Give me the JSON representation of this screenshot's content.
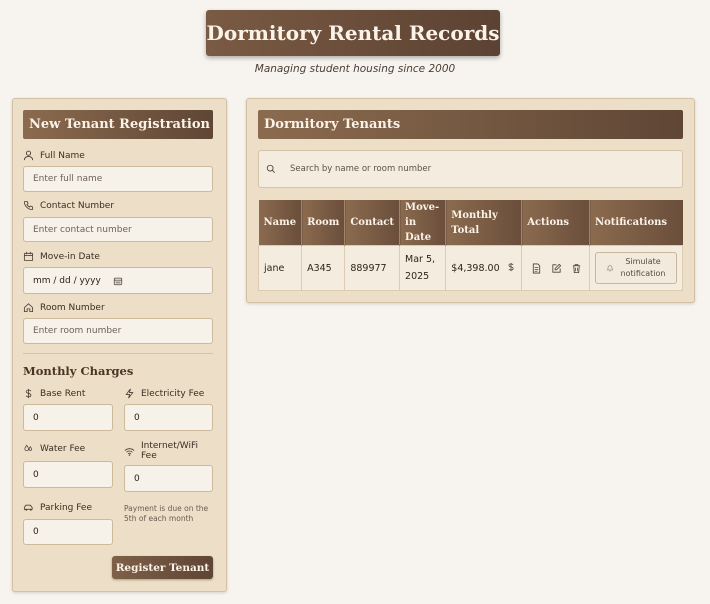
{
  "header": {
    "title": "Dormitory Rental Records",
    "subtitle": "Managing student housing since 2000"
  },
  "form": {
    "title": "New Tenant Registration",
    "full_name": {
      "label": "Full Name",
      "placeholder": "Enter full name"
    },
    "contact": {
      "label": "Contact Number",
      "placeholder": "Enter contact number"
    },
    "move_in": {
      "label": "Move-in Date",
      "placeholder": "mm / dd / yyyy"
    },
    "room": {
      "label": "Room Number",
      "placeholder": "Enter room number"
    },
    "charges_title": "Monthly Charges",
    "base_rent": {
      "label": "Base Rent",
      "value": "0"
    },
    "electricity": {
      "label": "Electricity Fee",
      "value": "0"
    },
    "water": {
      "label": "Water Fee",
      "value": "0"
    },
    "internet": {
      "label": "Internet/WiFi Fee",
      "value": "0"
    },
    "parking": {
      "label": "Parking Fee",
      "value": "0"
    },
    "note": "Payment is due on the 5th of each month",
    "submit_label": "Register Tenant"
  },
  "tenants": {
    "title": "Dormitory Tenants",
    "search_placeholder": "Search by name or room number",
    "columns": [
      "Name",
      "Room",
      "Contact",
      "Move-in Date",
      "Monthly Total",
      "Actions",
      "Notifications"
    ],
    "rows": [
      {
        "name": "jane",
        "room": "A345",
        "contact": "889977",
        "move_in": "Mar 5, 2025",
        "total": "$4,398.00",
        "notify_label": "Simulate notification"
      }
    ]
  },
  "colors": {
    "accent": "#6e5140",
    "panel": "#ecdec7",
    "background": "#f7f4ef"
  },
  "icons": [
    "user-icon",
    "phone-icon",
    "calendar-icon",
    "home-icon",
    "dollar-icon",
    "bolt-icon",
    "droplet-icon",
    "wifi-icon",
    "car-icon",
    "search-icon",
    "document-icon",
    "edit-icon",
    "trash-icon",
    "bell-icon"
  ]
}
